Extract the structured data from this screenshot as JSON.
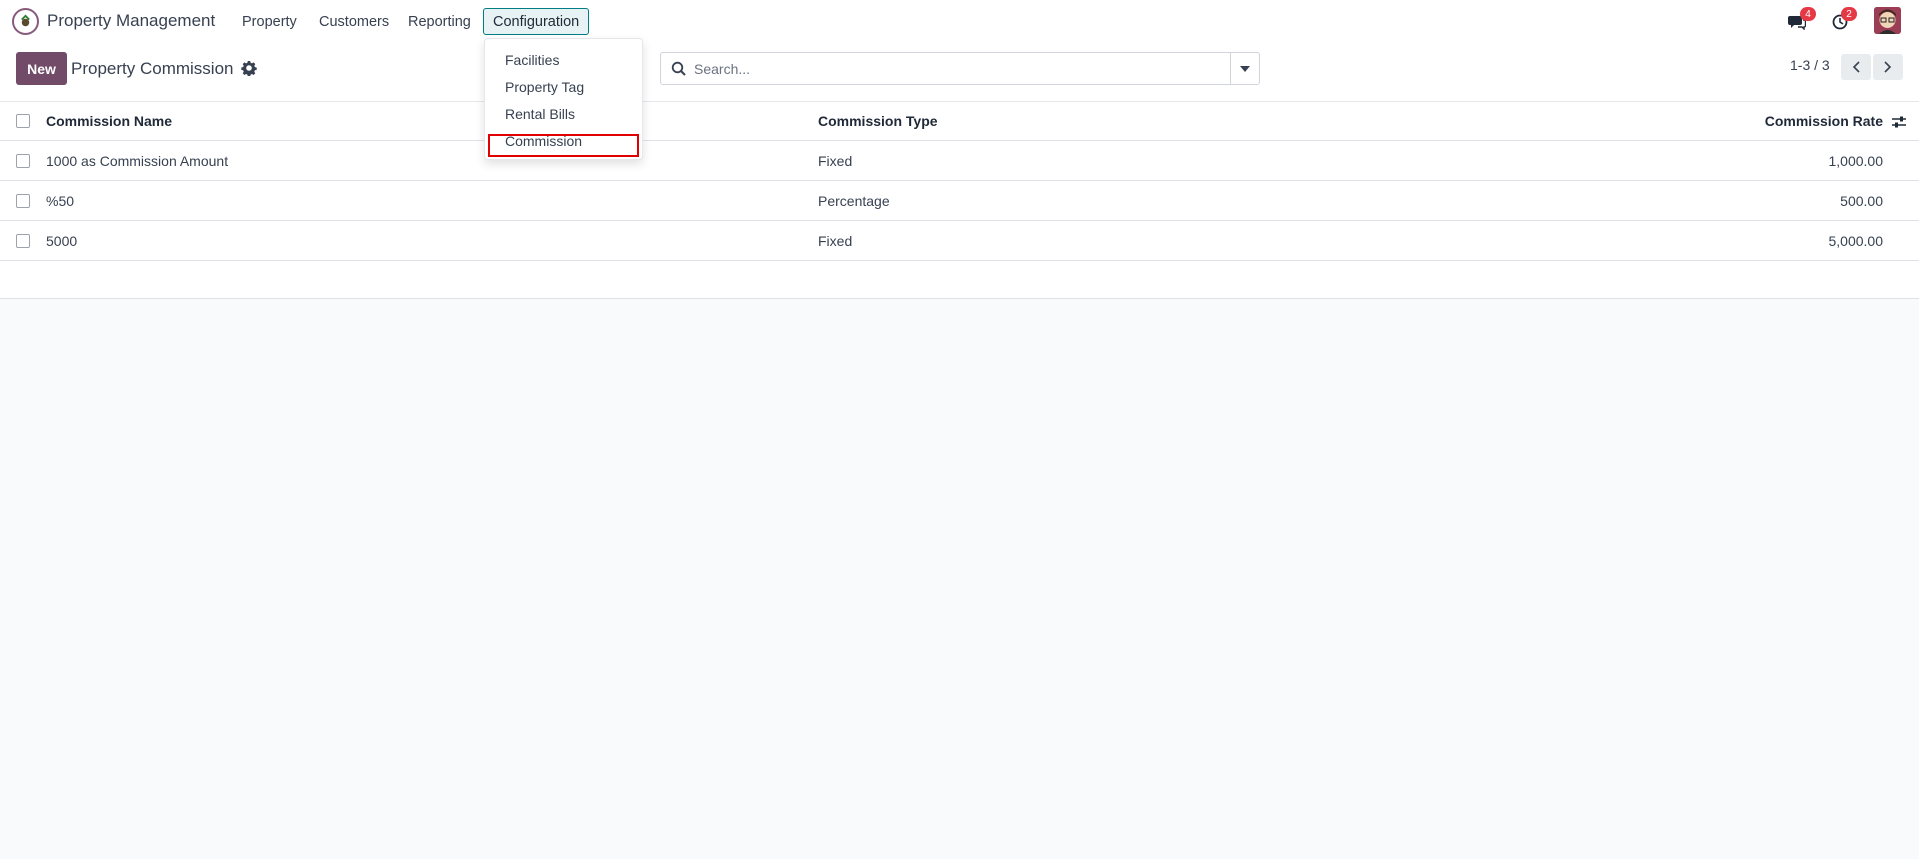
{
  "navbar": {
    "brand": "Property Management",
    "menus": [
      "Property",
      "Customers",
      "Reporting",
      "Configuration"
    ],
    "messages_count": "4",
    "activities_count": "2"
  },
  "configuration_menu": {
    "items": [
      "Facilities",
      "Property Tag",
      "Rental Bills",
      "Commission"
    ],
    "highlighted_item": "Commission"
  },
  "control_panel": {
    "new_label": "New",
    "title": "Property Commission",
    "search_placeholder": "Search...",
    "pager": "1-3 / 3"
  },
  "table": {
    "columns": [
      "Commission Name",
      "Commission Type",
      "Commission Rate"
    ],
    "rows": [
      {
        "name": "1000 as Commission Amount",
        "type": "Fixed",
        "rate": "1,000.00"
      },
      {
        "name": "%50",
        "type": "Percentage",
        "rate": "500.00"
      },
      {
        "name": "5000",
        "type": "Fixed",
        "rate": "5,000.00"
      }
    ]
  },
  "colors": {
    "brand_purple": "#714b67",
    "active_menu_border": "#017e84",
    "badge_red": "#e63946",
    "highlight_red": "#e00000"
  }
}
